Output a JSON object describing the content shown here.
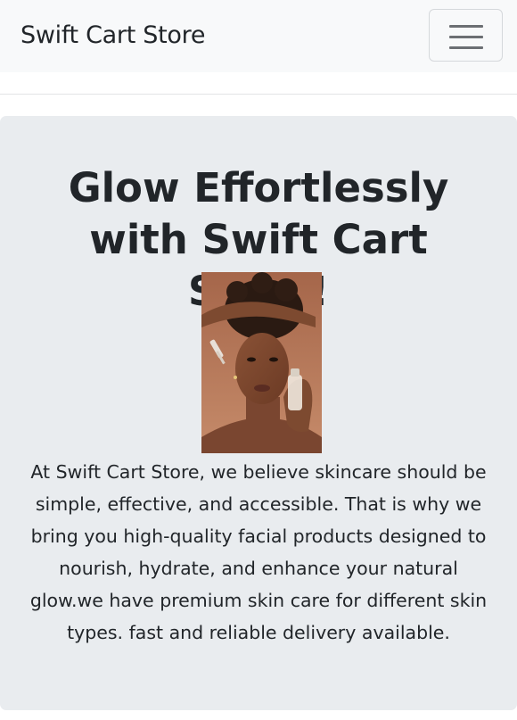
{
  "navbar": {
    "brand": "Swift Cart Store",
    "toggler_icon": "hamburger-menu-icon"
  },
  "hero": {
    "title": "Glow Effortlessly with Swift Cart Store!",
    "image_alt": "woman holding serum dropper bottle",
    "description": "At Swift Cart Store, we believe skincare should be simple, effective, and accessible. That is why we bring you high-quality facial products designed to nourish, hydrate, and enhance your natural glow.we have premium skin care for different skin types. fast and reliable delivery available."
  },
  "colors": {
    "navbar_bg": "#f8f9fa",
    "hero_bg": "#e9ecef",
    "text": "#212529"
  }
}
